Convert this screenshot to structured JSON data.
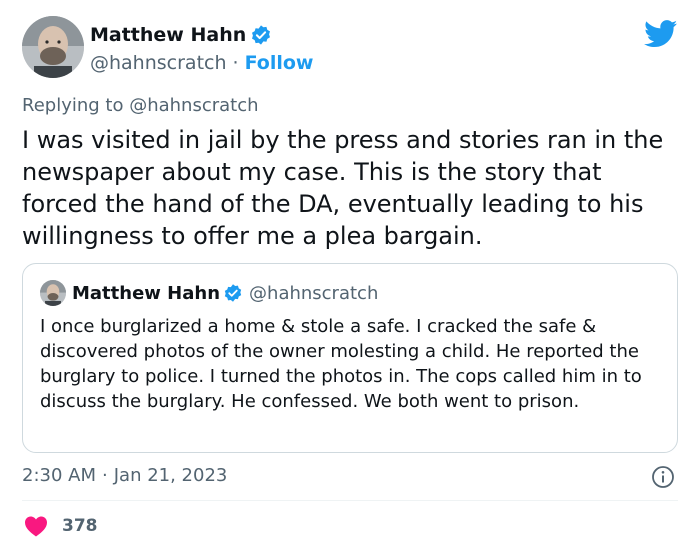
{
  "author": {
    "display_name": "Matthew Hahn",
    "handle": "@hahnscratch",
    "separator": "·",
    "follow_label": "Follow"
  },
  "reply_context": {
    "text": "Replying to @hahnscratch"
  },
  "tweet": {
    "text": "I was visited in jail by the press and stories ran in the newspaper about my case. This is the story that forced the hand of the DA, eventually leading to his willingness to offer me a plea bargain."
  },
  "quoted_tweet": {
    "display_name": "Matthew Hahn",
    "handle": "@hahnscratch",
    "text": "I once burglarized a home & stole a safe. I cracked the safe & discovered photos of the owner molesting a child. He reported the burglary to police. I turned the photos in. The cops called him in to discuss the burglary. He confessed.  We both went to prison."
  },
  "meta": {
    "time": "2:30 AM",
    "separator": "·",
    "date": "Jan 21, 2023"
  },
  "engagement": {
    "likes": "378"
  },
  "icons": {
    "verified": "verified-badge-icon",
    "brand": "twitter-bird-icon",
    "info": "info-icon",
    "like": "heart-icon"
  },
  "colors": {
    "accent": "#1d9bf0",
    "like": "#f91880",
    "text_primary": "#0f1419",
    "text_secondary": "#536471",
    "border": "#cfd9de"
  }
}
